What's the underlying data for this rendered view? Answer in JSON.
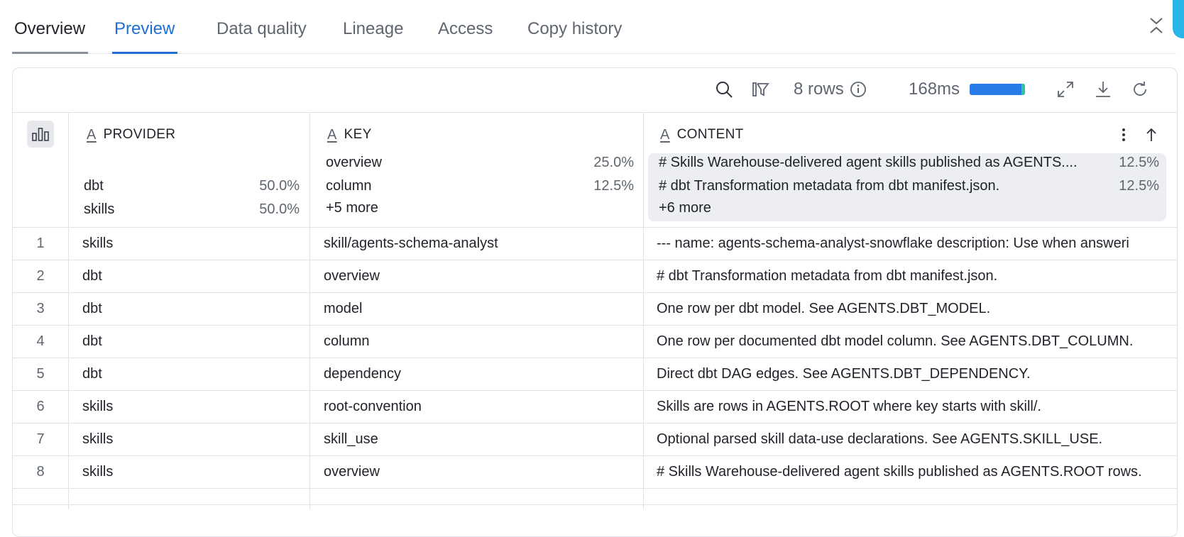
{
  "tabs": [
    {
      "label": "Overview"
    },
    {
      "label": "Preview"
    },
    {
      "label": "Data quality"
    },
    {
      "label": "Lineage"
    },
    {
      "label": "Access"
    },
    {
      "label": "Copy history"
    }
  ],
  "toolbar": {
    "rows_label": "8 rows",
    "duration": "168ms"
  },
  "columns": [
    {
      "type_glyph": "A",
      "name": "PROVIDER"
    },
    {
      "type_glyph": "A",
      "name": "KEY"
    },
    {
      "type_glyph": "A",
      "name": "CONTENT"
    }
  ],
  "distribution": {
    "provider": [
      {
        "value": "dbt",
        "pct": "50.0%"
      },
      {
        "value": "skills",
        "pct": "50.0%"
      }
    ],
    "key": [
      {
        "value": "overview",
        "pct": "25.0%"
      },
      {
        "value": "column",
        "pct": "12.5%"
      }
    ],
    "key_more": "+5 more",
    "content": [
      {
        "value": "# Skills Warehouse-delivered agent skills published as AGENTS....",
        "pct": "12.5%"
      },
      {
        "value": "# dbt Transformation metadata from dbt manifest.json.",
        "pct": "12.5%"
      }
    ],
    "content_more": "+6 more"
  },
  "rows": [
    {
      "n": "1",
      "provider": "skills",
      "key": "skill/agents-schema-analyst",
      "content": "--- name: agents-schema-analyst-snowflake description: Use when answeri"
    },
    {
      "n": "2",
      "provider": "dbt",
      "key": "overview",
      "content": "# dbt Transformation metadata from dbt manifest.json."
    },
    {
      "n": "3",
      "provider": "dbt",
      "key": "model",
      "content": "One row per dbt model. See AGENTS.DBT_MODEL."
    },
    {
      "n": "4",
      "provider": "dbt",
      "key": "column",
      "content": "One row per documented dbt model column. See AGENTS.DBT_COLUMN."
    },
    {
      "n": "5",
      "provider": "dbt",
      "key": "dependency",
      "content": "Direct dbt DAG edges. See AGENTS.DBT_DEPENDENCY."
    },
    {
      "n": "6",
      "provider": "skills",
      "key": "root-convention",
      "content": "Skills are rows in AGENTS.ROOT where key starts with skill/."
    },
    {
      "n": "7",
      "provider": "skills",
      "key": "skill_use",
      "content": "Optional parsed skill data-use declarations. See AGENTS.SKILL_USE."
    },
    {
      "n": "8",
      "provider": "skills",
      "key": "overview",
      "content": "# Skills Warehouse-delivered agent skills published as AGENTS.ROOT rows."
    }
  ],
  "colors": {
    "accent": "#1f6fd6",
    "brand_side": "#29b5e8",
    "bar": "#2a7bea",
    "bar_tail": "#2ec4a0"
  }
}
